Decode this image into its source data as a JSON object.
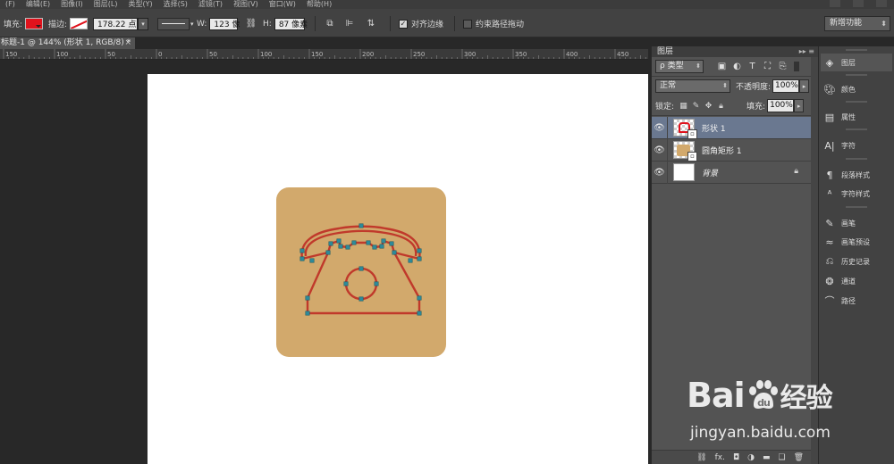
{
  "menubar": {
    "items": [
      "(F)",
      "编辑(E)",
      "图像(I)",
      "图层(L)",
      "类型(Y)",
      "选择(S)",
      "滤镜(T)",
      "视图(V)",
      "窗口(W)",
      "帮助(H)"
    ]
  },
  "options": {
    "fill_label": "填充:",
    "stroke_label": "描边:",
    "stroke_width": "178.22 点",
    "w_label": "W:",
    "w_value": "123 像",
    "h_label": "H:",
    "h_value": "87 像素",
    "align_edges_label": "对齐边缘",
    "align_edges_checked": true,
    "constrain_path_label": "约束路径拖动",
    "constrain_path_checked": false,
    "workspace": "新增功能",
    "fill_color": "#e0121c",
    "stroke_color": "#e0121c"
  },
  "document": {
    "tab_title": "标题-1 @ 144% (形状 1, RGB/8) *",
    "close_glyph": "×"
  },
  "ruler": {
    "labels": [
      "150",
      "100",
      "50",
      "0",
      "50",
      "100",
      "150",
      "200",
      "250",
      "300",
      "350",
      "400",
      "450"
    ]
  },
  "canvas": {
    "tile_color": "#d2a96c",
    "path_color": "#c0392b",
    "anchor_color": "#2e8b9a"
  },
  "layers_panel": {
    "title": "图层",
    "filter_label": "ρ 类型",
    "blend_mode": "正常",
    "opacity_label": "不透明度:",
    "opacity_value": "100%",
    "lock_label": "锁定:",
    "fill_label": "填充:",
    "fill_value": "100%",
    "layers": [
      {
        "name": "形状 1",
        "selected": true,
        "kind": "shape"
      },
      {
        "name": "圆角矩形 1",
        "selected": false,
        "kind": "rect"
      },
      {
        "name": "背景",
        "selected": false,
        "kind": "background",
        "locked": true
      }
    ],
    "footer_icons": [
      "link-icon",
      "fx-icon",
      "mask-icon",
      "adjustment-icon",
      "folder-icon",
      "new-layer-icon",
      "trash-icon"
    ],
    "footer_fx": "fx."
  },
  "dock": {
    "items": [
      {
        "label": "图层",
        "icon": "layers-icon",
        "active": true
      },
      {
        "label": "颜色",
        "icon": "color-icon"
      },
      {
        "label": "属性",
        "icon": "properties-icon"
      },
      {
        "label": "字符",
        "icon": "character-icon"
      },
      {
        "label": "段落样式",
        "icon": "paragraph-styles-icon"
      },
      {
        "label": "字符样式",
        "icon": "character-styles-icon"
      },
      {
        "label": "画笔",
        "icon": "brush-icon"
      },
      {
        "label": "画笔预设",
        "icon": "brush-presets-icon"
      },
      {
        "label": "历史记录",
        "icon": "history-icon"
      },
      {
        "label": "通道",
        "icon": "channels-icon"
      },
      {
        "label": "路径",
        "icon": "paths-icon"
      }
    ]
  },
  "watermark": {
    "brand_left": "Bai",
    "brand_right": "经验",
    "url": "jingyan.baidu.com"
  }
}
